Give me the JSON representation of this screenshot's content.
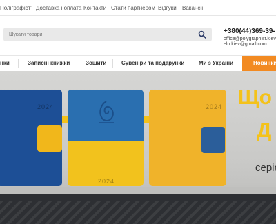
{
  "topnav": {
    "items": [
      "Поліграфіст\"",
      "Доставка і оплата",
      "Контакти",
      "Стати партнером",
      "Відгуки",
      "Вакансії"
    ]
  },
  "search": {
    "placeholder": "Шукати товари"
  },
  "contacts": {
    "phone": "+380(44)369-39-",
    "email1": "office@polygraphist.kiev",
    "email2": "elo.kiev@gmail.com"
  },
  "categories": {
    "items": [
      "нки",
      "Записні книжки",
      "Зошити",
      "Сувеніри та подарунки",
      "Ми з України"
    ],
    "news_label": "Новинки"
  },
  "banner": {
    "headline1": "Що",
    "headline2": "Д",
    "subtext": "серіє",
    "year_labels": [
      "2024",
      "2024",
      "2024"
    ]
  },
  "colors": {
    "accent": "#f28a22",
    "ukraine_blue": "#2a6fb0",
    "ukraine_yellow": "#f2c21d"
  }
}
